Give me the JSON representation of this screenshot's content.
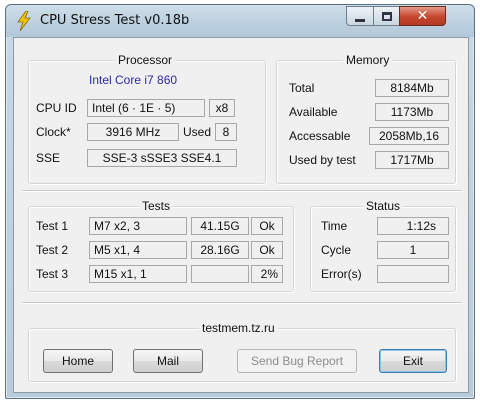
{
  "window": {
    "title": "CPU Stress Test  v0.18b"
  },
  "processor": {
    "legend": "Processor",
    "name": "Intel Core i7  860",
    "cpuid_label": "CPU ID",
    "cpuid_value": "Intel  (6 · 1E · 5)",
    "cpuid_threads": "x8",
    "clock_label": "Clock*",
    "clock_value": "3916 MHz",
    "used_label": "Used",
    "used_value": "8",
    "sse_label": "SSE",
    "sse_value": "SSE-3 sSSE3 SSE4.1"
  },
  "memory": {
    "legend": "Memory",
    "total_label": "Total",
    "total_value": "8184Mb",
    "available_label": "Available",
    "available_value": "1173Mb",
    "accessable_label": "Accessable",
    "accessable_value": "2058Mb,16",
    "usedbytest_label": "Used by test",
    "usedbytest_value": "1717Mb"
  },
  "tests": {
    "legend": "Tests",
    "rows": [
      {
        "label": "Test  1",
        "name": "M7 x2, 3",
        "value": "41.15G",
        "status": "Ok"
      },
      {
        "label": "Test  2",
        "name": "M5 x1, 4",
        "value": "28.16G",
        "status": "Ok"
      },
      {
        "label": "Test  3",
        "name": "M15 x1, 1",
        "value": "",
        "status": "2%"
      }
    ]
  },
  "status": {
    "legend": "Status",
    "time_label": "Time",
    "time_value": "1:12s",
    "cycle_label": "Cycle",
    "cycle_value": "1",
    "errors_label": "Error(s)",
    "errors_value": ""
  },
  "footer": {
    "legend": "testmem.tz.ru",
    "home": "Home",
    "mail": "Mail",
    "bug": "Send Bug Report",
    "exit": "Exit"
  }
}
